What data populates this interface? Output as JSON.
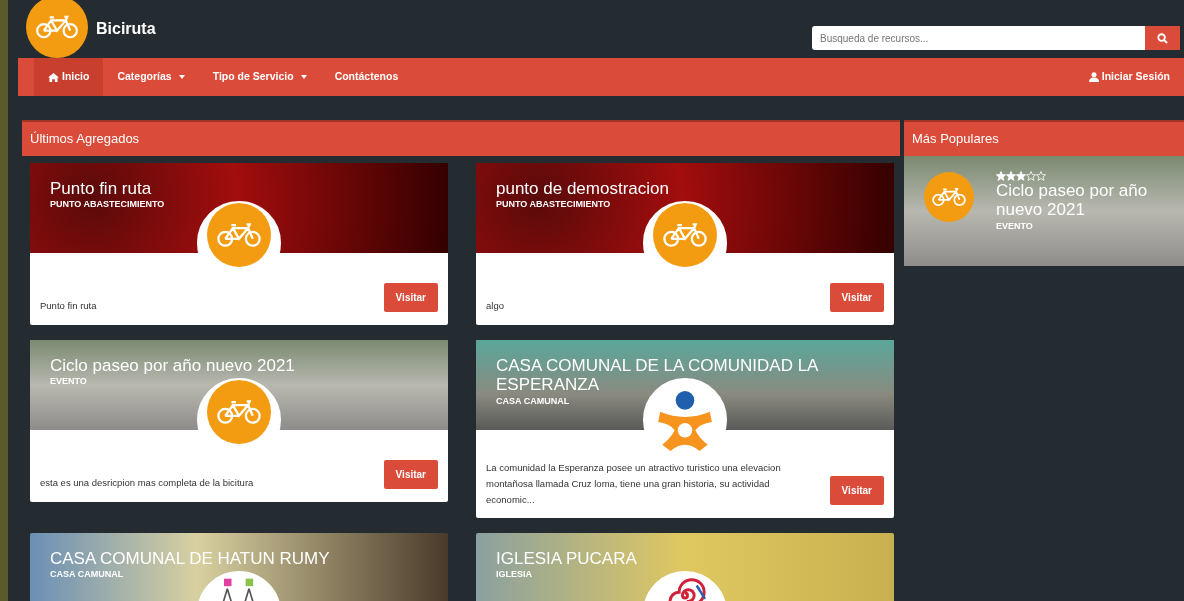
{
  "brand": {
    "title": "Biciruta"
  },
  "search": {
    "placeholder": "Busqueda de recursos..."
  },
  "nav": [
    {
      "label": "Inicio",
      "dropdown": false,
      "selected": true
    },
    {
      "label": "Categorías",
      "dropdown": true,
      "selected": false
    },
    {
      "label": "Tipo de Servicio",
      "dropdown": true,
      "selected": false
    },
    {
      "label": "Contáctenos",
      "dropdown": false,
      "selected": false
    }
  ],
  "login": {
    "label": "Iniciar Sesión"
  },
  "latest": {
    "title": "Últimos Agregados",
    "cards": [
      {
        "title": "Punto fin ruta",
        "category": "PUNTO ABASTECIMIENTO",
        "kind": "bike",
        "description": "Punto fin ruta",
        "button": "Visitar"
      },
      {
        "title": "punto de demostracion",
        "category": "PUNTO ABASTECIMIENTO",
        "kind": "bike",
        "description": "algo",
        "button": "Visitar"
      },
      {
        "title": "Ciclo paseo por año nuevo 2021",
        "category": "EVENTO",
        "kind": "bike",
        "description": "esta es una desricpion mas completa de la bicitura",
        "button": "Visitar"
      },
      {
        "title": "CASA COMUNAL DE LA COMUNIDAD LA ESPERANZA",
        "category": "CASA CAMUNAL",
        "kind": "people",
        "description": "La comunidad la Esperanza posee un atractivo turistico una elevacion montañosa llamada Cruz loma, tiene una gran historia, su actividad economic...",
        "button": "Visitar"
      },
      {
        "title": "CASA COMUNAL DE HATUN RUMY",
        "category": "CASA CAMUNAL",
        "kind": "figures"
      },
      {
        "title": "IGLESIA PUCARA",
        "category": "IGLESIA",
        "kind": "spiral"
      }
    ]
  },
  "popular": {
    "title": "Más Populares",
    "items": [
      {
        "title": "Ciclo paseo por año nuevo 2021",
        "category": "EVENTO",
        "kind": "bike",
        "stars": 3
      }
    ]
  }
}
